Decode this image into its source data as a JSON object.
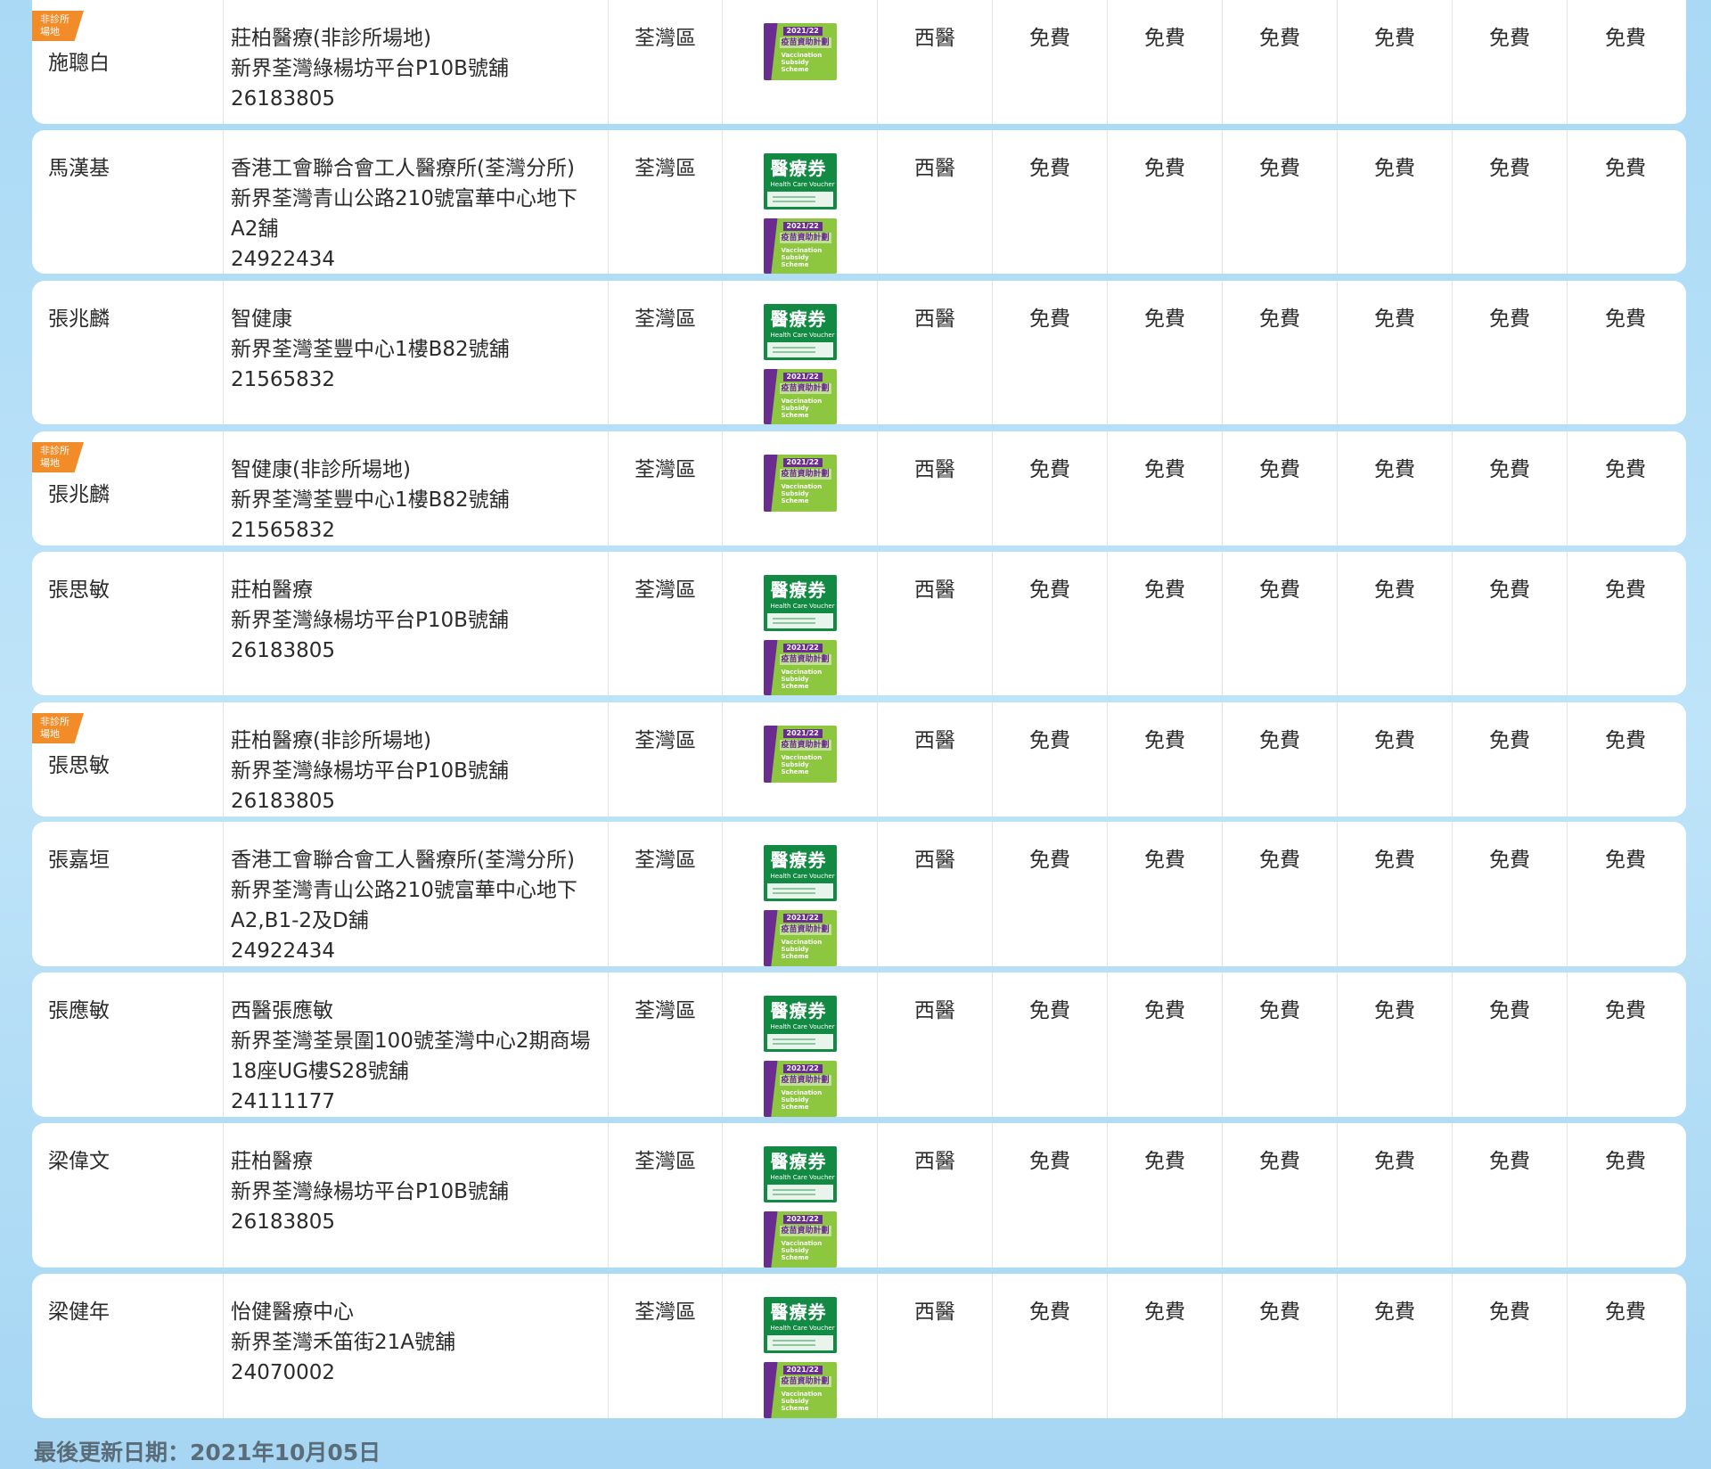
{
  "non_clinic_flag": "非診所\n場地",
  "badges": {
    "voucher": {
      "zh": "醫療券",
      "en": "Health Care Voucher"
    },
    "vaccination": {
      "year": "2021/22",
      "zh": "疫苗資助計劃",
      "en": "Vaccination Subsidy Scheme"
    }
  },
  "rows": [
    {
      "name": "施聰白",
      "non_clinic": true,
      "clinic": "莊柏醫療(非診所場地)",
      "address_lines": [
        "新界荃灣綠楊坊平台P10B號舖"
      ],
      "phone": "26183805",
      "district": "荃灣區",
      "voucher": false,
      "vaccination": true,
      "type": "西醫",
      "fees": [
        "免費",
        "免費",
        "免費",
        "免費",
        "免費",
        "免費"
      ]
    },
    {
      "name": "馬漢基",
      "non_clinic": false,
      "clinic": "香港工會聯合會工人醫療所(荃灣分所)",
      "address_lines": [
        "新界荃灣青山公路210號富華中心地下",
        "A2舖"
      ],
      "phone": "24922434",
      "district": "荃灣區",
      "voucher": true,
      "vaccination": true,
      "type": "西醫",
      "fees": [
        "免費",
        "免費",
        "免費",
        "免費",
        "免費",
        "免費"
      ]
    },
    {
      "name": "張兆麟",
      "non_clinic": false,
      "clinic": "智健康",
      "address_lines": [
        "新界荃灣荃豐中心1樓B82號舖"
      ],
      "phone": "21565832",
      "district": "荃灣區",
      "voucher": true,
      "vaccination": true,
      "type": "西醫",
      "fees": [
        "免費",
        "免費",
        "免費",
        "免費",
        "免費",
        "免費"
      ]
    },
    {
      "name": "張兆麟",
      "non_clinic": true,
      "clinic": "智健康(非診所場地)",
      "address_lines": [
        "新界荃灣荃豐中心1樓B82號舖"
      ],
      "phone": "21565832",
      "district": "荃灣區",
      "voucher": false,
      "vaccination": true,
      "type": "西醫",
      "fees": [
        "免費",
        "免費",
        "免費",
        "免費",
        "免費",
        "免費"
      ]
    },
    {
      "name": "張思敏",
      "non_clinic": false,
      "clinic": "莊柏醫療",
      "address_lines": [
        "新界荃灣綠楊坊平台P10B號舖"
      ],
      "phone": "26183805",
      "district": "荃灣區",
      "voucher": true,
      "vaccination": true,
      "type": "西醫",
      "fees": [
        "免費",
        "免費",
        "免費",
        "免費",
        "免費",
        "免費"
      ]
    },
    {
      "name": "張思敏",
      "non_clinic": true,
      "clinic": "莊柏醫療(非診所場地)",
      "address_lines": [
        "新界荃灣綠楊坊平台P10B號舖"
      ],
      "phone": "26183805",
      "district": "荃灣區",
      "voucher": false,
      "vaccination": true,
      "type": "西醫",
      "fees": [
        "免費",
        "免費",
        "免費",
        "免費",
        "免費",
        "免費"
      ]
    },
    {
      "name": "張嘉垣",
      "non_clinic": false,
      "clinic": "香港工會聯合會工人醫療所(荃灣分所)",
      "address_lines": [
        "新界荃灣青山公路210號富華中心地下",
        "A2,B1-2及D舖"
      ],
      "phone": "24922434",
      "district": "荃灣區",
      "voucher": true,
      "vaccination": true,
      "type": "西醫",
      "fees": [
        "免費",
        "免費",
        "免費",
        "免費",
        "免費",
        "免費"
      ]
    },
    {
      "name": "張應敏",
      "non_clinic": false,
      "clinic": "西醫張應敏",
      "address_lines": [
        "新界荃灣荃景圍100號荃灣中心2期商場",
        "18座UG樓S28號舖"
      ],
      "phone": "24111177",
      "district": "荃灣區",
      "voucher": true,
      "vaccination": true,
      "type": "西醫",
      "fees": [
        "免費",
        "免費",
        "免費",
        "免費",
        "免費",
        "免費"
      ]
    },
    {
      "name": "梁偉文",
      "non_clinic": false,
      "clinic": "莊柏醫療",
      "address_lines": [
        "新界荃灣綠楊坊平台P10B號舖"
      ],
      "phone": "26183805",
      "district": "荃灣區",
      "voucher": true,
      "vaccination": true,
      "type": "西醫",
      "fees": [
        "免費",
        "免費",
        "免費",
        "免費",
        "免費",
        "免費"
      ]
    },
    {
      "name": "梁健年",
      "non_clinic": false,
      "clinic": "怡健醫療中心",
      "address_lines": [
        "新界荃灣禾笛街21A號舖"
      ],
      "phone": "24070002",
      "district": "荃灣區",
      "voucher": true,
      "vaccination": true,
      "type": "西醫",
      "fees": [
        "免費",
        "免費",
        "免費",
        "免費",
        "免費",
        "免費"
      ]
    }
  ],
  "footer": {
    "last_updated": "最後更新日期：2021年10月05日"
  }
}
